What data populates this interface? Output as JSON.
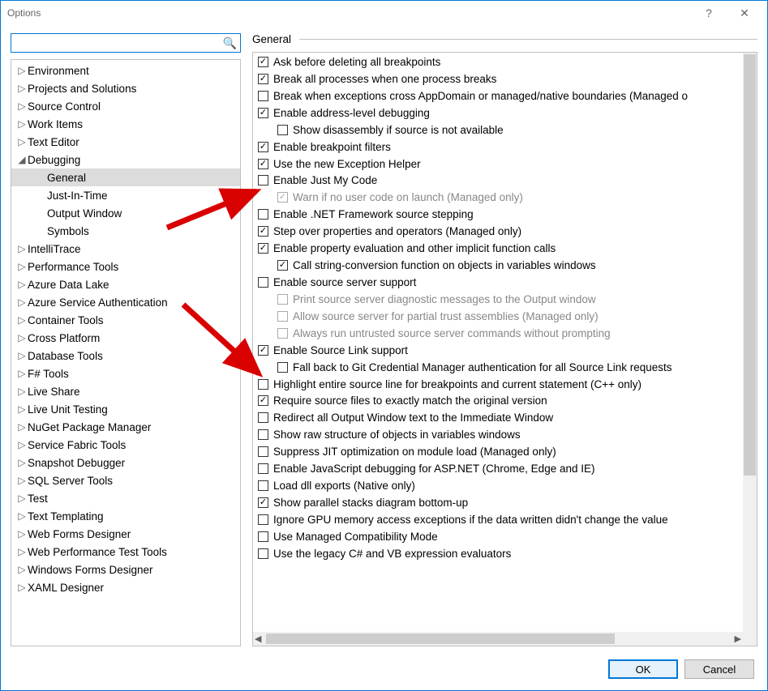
{
  "window": {
    "title": "Options"
  },
  "section": {
    "title": "General"
  },
  "search": {
    "value": ""
  },
  "buttons": {
    "ok": "OK",
    "cancel": "Cancel"
  },
  "tree": [
    {
      "label": "Environment",
      "exp": "▷"
    },
    {
      "label": "Projects and Solutions",
      "exp": "▷"
    },
    {
      "label": "Source Control",
      "exp": "▷"
    },
    {
      "label": "Work Items",
      "exp": "▷"
    },
    {
      "label": "Text Editor",
      "exp": "▷"
    },
    {
      "label": "Debugging",
      "exp": "◢",
      "children": [
        {
          "label": "General",
          "selected": true
        },
        {
          "label": "Just-In-Time"
        },
        {
          "label": "Output Window"
        },
        {
          "label": "Symbols"
        }
      ]
    },
    {
      "label": "IntelliTrace",
      "exp": "▷"
    },
    {
      "label": "Performance Tools",
      "exp": "▷"
    },
    {
      "label": "Azure Data Lake",
      "exp": "▷"
    },
    {
      "label": "Azure Service Authentication",
      "exp": "▷"
    },
    {
      "label": "Container Tools",
      "exp": "▷"
    },
    {
      "label": "Cross Platform",
      "exp": "▷"
    },
    {
      "label": "Database Tools",
      "exp": "▷"
    },
    {
      "label": "F# Tools",
      "exp": "▷"
    },
    {
      "label": "Live Share",
      "exp": "▷"
    },
    {
      "label": "Live Unit Testing",
      "exp": "▷"
    },
    {
      "label": "NuGet Package Manager",
      "exp": "▷"
    },
    {
      "label": "Service Fabric Tools",
      "exp": "▷"
    },
    {
      "label": "Snapshot Debugger",
      "exp": "▷"
    },
    {
      "label": "SQL Server Tools",
      "exp": "▷"
    },
    {
      "label": "Test",
      "exp": "▷"
    },
    {
      "label": "Text Templating",
      "exp": "▷"
    },
    {
      "label": "Web Forms Designer",
      "exp": "▷"
    },
    {
      "label": "Web Performance Test Tools",
      "exp": "▷"
    },
    {
      "label": "Windows Forms Designer",
      "exp": "▷"
    },
    {
      "label": "XAML Designer",
      "exp": "▷"
    }
  ],
  "options": [
    {
      "label": "Ask before deleting all breakpoints",
      "checked": true,
      "indent": 0
    },
    {
      "label": "Break all processes when one process breaks",
      "checked": true,
      "indent": 0
    },
    {
      "label": "Break when exceptions cross AppDomain or managed/native boundaries (Managed o",
      "checked": false,
      "indent": 0
    },
    {
      "label": "Enable address-level debugging",
      "checked": true,
      "indent": 0
    },
    {
      "label": "Show disassembly if source is not available",
      "checked": false,
      "indent": 1
    },
    {
      "label": "Enable breakpoint filters",
      "checked": true,
      "indent": 0
    },
    {
      "label": "Use the new Exception Helper",
      "checked": true,
      "indent": 0
    },
    {
      "label": "Enable Just My Code",
      "checked": false,
      "indent": 0
    },
    {
      "label": "Warn if no user code on launch (Managed only)",
      "checked": true,
      "indent": 1,
      "disabled": true
    },
    {
      "label": "Enable .NET Framework source stepping",
      "checked": false,
      "indent": 0
    },
    {
      "label": "Step over properties and operators (Managed only)",
      "checked": true,
      "indent": 0
    },
    {
      "label": "Enable property evaluation and other implicit function calls",
      "checked": true,
      "indent": 0
    },
    {
      "label": "Call string-conversion function on objects in variables windows",
      "checked": true,
      "indent": 1
    },
    {
      "label": "Enable source server support",
      "checked": false,
      "indent": 0
    },
    {
      "label": "Print source server diagnostic messages to the Output window",
      "checked": false,
      "indent": 1,
      "disabled": true
    },
    {
      "label": "Allow source server for partial trust assemblies (Managed only)",
      "checked": false,
      "indent": 1,
      "disabled": true
    },
    {
      "label": "Always run untrusted source server commands without prompting",
      "checked": false,
      "indent": 1,
      "disabled": true
    },
    {
      "label": "Enable Source Link support",
      "checked": true,
      "indent": 0
    },
    {
      "label": "Fall back to Git Credential Manager authentication for all Source Link requests",
      "checked": false,
      "indent": 1
    },
    {
      "label": "Highlight entire source line for breakpoints and current statement (C++ only)",
      "checked": false,
      "indent": 0
    },
    {
      "label": "Require source files to exactly match the original version",
      "checked": true,
      "indent": 0
    },
    {
      "label": "Redirect all Output Window text to the Immediate Window",
      "checked": false,
      "indent": 0
    },
    {
      "label": "Show raw structure of objects in variables windows",
      "checked": false,
      "indent": 0
    },
    {
      "label": "Suppress JIT optimization on module load (Managed only)",
      "checked": false,
      "indent": 0
    },
    {
      "label": "Enable JavaScript debugging for ASP.NET (Chrome, Edge and IE)",
      "checked": false,
      "indent": 0
    },
    {
      "label": "Load dll exports (Native only)",
      "checked": false,
      "indent": 0
    },
    {
      "label": "Show parallel stacks diagram bottom-up",
      "checked": true,
      "indent": 0
    },
    {
      "label": "Ignore GPU memory access exceptions if the data written didn't change the value",
      "checked": false,
      "indent": 0
    },
    {
      "label": "Use Managed Compatibility Mode",
      "checked": false,
      "indent": 0
    },
    {
      "label": "Use the legacy C# and VB expression evaluators",
      "checked": false,
      "indent": 0
    }
  ]
}
